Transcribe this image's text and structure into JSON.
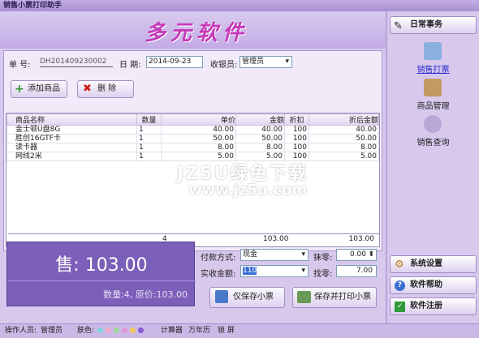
{
  "window": {
    "title": "销售小票打印助手"
  },
  "banner": {
    "logo": "多元软件"
  },
  "form": {
    "order_label": "单 号:",
    "order_no": "DH201409230002",
    "date_label": "日 期:",
    "date": "2014-09-23",
    "cashier_label": "收银员:",
    "cashier": "管理员"
  },
  "toolbar": {
    "add": "添加商品",
    "delete": "删 除"
  },
  "table": {
    "headers": [
      "商品名称",
      "数量",
      "单价",
      "金额",
      "折扣",
      "折后金额"
    ],
    "rows": [
      [
        "金士顿U盘8G",
        "1",
        "40.00",
        "40.00",
        "100",
        "40.00"
      ],
      [
        "胜创16GTF卡",
        "1",
        "50.00",
        "50.00",
        "100",
        "50.00"
      ],
      [
        "读卡器",
        "1",
        "8.00",
        "8.00",
        "100",
        "8.00"
      ],
      [
        "网线2米",
        "1",
        "5.00",
        "5.00",
        "100",
        "5.00"
      ]
    ],
    "total_qty": "4",
    "total_amount": "103.00",
    "total_after": "103.00"
  },
  "summary": {
    "big": "售: 103.00",
    "small": "数量:4, 原价:103.00"
  },
  "payment": {
    "method_label": "付款方式:",
    "method": "现金",
    "round_label": "抹零:",
    "round": "0.00",
    "received_label": "实收金额:",
    "received": "110",
    "change_label": "找零:",
    "change": "7.00",
    "save": "仅保存小票",
    "save_print": "保存并打印小票"
  },
  "sidebar": {
    "header": "日常事务",
    "items": [
      "销售打票",
      "商品管理",
      "销售查询"
    ],
    "bottom": [
      "系统设置",
      "软件帮助",
      "软件注册"
    ]
  },
  "status": {
    "operator_label": "操作人员:",
    "operator": "管理员",
    "skin_label": "肤色:",
    "calc": "计算器",
    "calendar": "万年历",
    "lock": "锁 屏"
  },
  "watermark": {
    "line1": "JZ5U绿色下载",
    "line2": "www.jz5u.com"
  }
}
